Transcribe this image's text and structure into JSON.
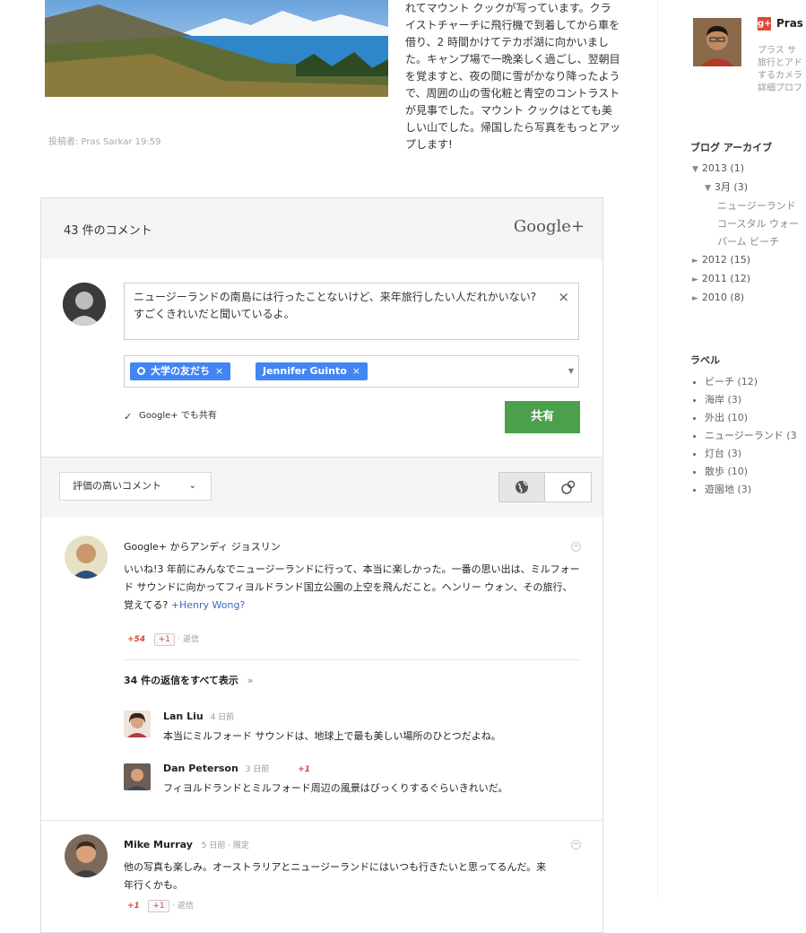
{
  "post": {
    "text": "れてマウント クックが写っています。クライストチャーチに飛行機で到着してから車を借り、2 時間かけてテカポ湖に向かいました。キャンプ場で一晩楽しく過ごし、翌朝目を覚ますと、夜の間に雪がかなり降ったようで、周囲の山の雪化粧と青空のコントラストが見事でした。マウント クックはとても美しい山でした。帰国したら写真をもっとアップします!",
    "meta": "投稿者: Pras Sarkar 19:59"
  },
  "widget": {
    "count": "43 件のコメント",
    "brand": "Google+",
    "composer": {
      "text": "ニュージーランドの南島には行ったことないけど、来年旅行したい人だれかいない?すごくきれいだと聞いているよ。",
      "close": "×"
    },
    "recipients": [
      {
        "label": "大学の友だち",
        "remove": "×"
      },
      {
        "label": "Jennifer Guinto",
        "remove": "×"
      }
    ],
    "also_share": "Google+ でも共有",
    "share_label": "共有",
    "sort_label": "評価の高いコメント",
    "colors": {
      "share": "#4ba04b",
      "chip": "#4285f4",
      "plus": "#d14836",
      "link": "#3a6bc4"
    }
  },
  "comments": [
    {
      "author": "Google+ からアンディ ジョスリン",
      "text_part1": "いいね!3 年前にみんなでニュージーランドに行って、本当に楽しかった。一番の思い出は、ミルフォード サウンドに向かってフィヨルドランド国立公園の上空を飛んだこと。ヘンリー ウォン、その旅行、覚えてる?",
      "mention": "+Henry Wong?",
      "plus_count": "+54",
      "plus_btn": "+1",
      "reply": "· 返信",
      "show_replies": "34 件の返信をすべて表示",
      "replies": [
        {
          "author": "Lan Liu",
          "time": "4 日前",
          "text": "本当にミルフォード サウンドは、地球上で最も美しい場所のひとつだよね。"
        },
        {
          "author": "Dan Peterson",
          "time": "3 日前",
          "plus": "+1",
          "text": "フィヨルドランドとミルフォード周辺の風景はびっくりするぐらいきれいだ。"
        }
      ]
    },
    {
      "author": "Mike Murray",
      "time": "5 日前 · 限定",
      "text": "他の写真も楽しみ。オーストラリアとニュージーランドにはいつも行きたいと思ってるんだ。来年行くかも。",
      "plus_count": "+1",
      "plus_btn": "+1",
      "reply": "· 返信"
    }
  ],
  "sidebar": {
    "name": "Pras",
    "bio": [
      "プラス サ",
      "旅行とアド",
      "するカメラ",
      "詳細プロフ"
    ],
    "archive_title": "ブログ アーカイブ",
    "archive": [
      {
        "label": "2013 (1)",
        "tri": "▼",
        "level": 0
      },
      {
        "label": "3月 (3)",
        "tri": "▼",
        "level": 1
      },
      {
        "label": "ニュージーランド",
        "tri": "",
        "level": 2
      },
      {
        "label": "コースタル ウォー",
        "tri": "",
        "level": 2
      },
      {
        "label": "パーム ビーチ",
        "tri": "",
        "level": 2
      },
      {
        "label": "2012 (15)",
        "tri": "►",
        "level": 0
      },
      {
        "label": "2011 (12)",
        "tri": "►",
        "level": 0
      },
      {
        "label": "2010 (8)",
        "tri": "►",
        "level": 0
      }
    ],
    "labels_title": "ラベル",
    "labels": [
      "ビーチ (12)",
      "海岸 (3)",
      "外出 (10)",
      "ニュージーランド (3",
      "灯台 (3)",
      "散歩 (10)",
      "遊園地 (3)"
    ]
  }
}
